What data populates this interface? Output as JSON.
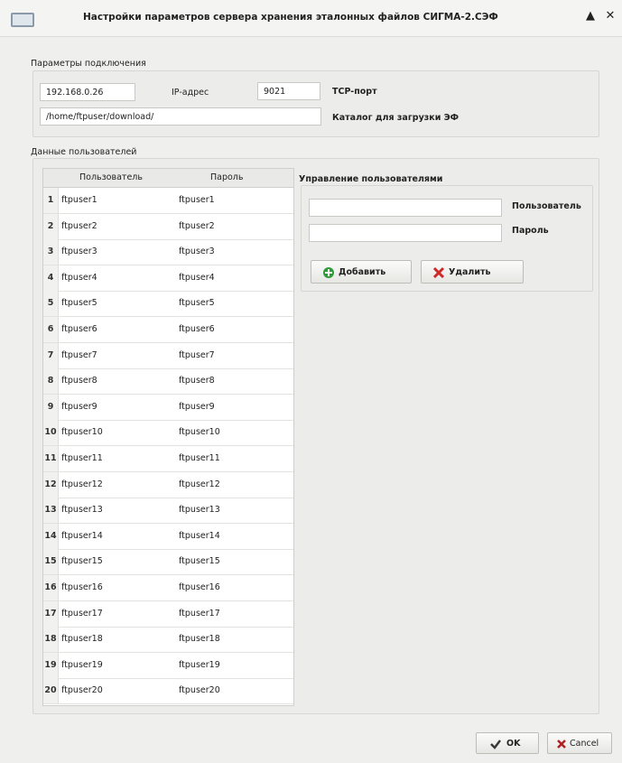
{
  "window": {
    "title": "Настройки параметров сервера хранения эталонных файлов СИГМА-2.СЭФ",
    "buttons": {
      "minimize": "▲",
      "close": "✕"
    }
  },
  "connection": {
    "group_label": "Параметры подключения",
    "ip_value": "192.168.0.26",
    "ip_label": "IP-адрес",
    "port_value": "9021",
    "port_label": "TCP-порт",
    "path_value": "/home/ftpuser/download/",
    "path_label": "Каталог для загрузки ЭФ"
  },
  "users": {
    "group_label": "Данные пользователей",
    "columns": [
      "Пользователь",
      "Пароль"
    ],
    "rows": [
      {
        "n": "1",
        "user": "ftpuser1",
        "pass": "ftpuser1"
      },
      {
        "n": "2",
        "user": "ftpuser2",
        "pass": "ftpuser2"
      },
      {
        "n": "3",
        "user": "ftpuser3",
        "pass": "ftpuser3"
      },
      {
        "n": "4",
        "user": "ftpuser4",
        "pass": "ftpuser4"
      },
      {
        "n": "5",
        "user": "ftpuser5",
        "pass": "ftpuser5"
      },
      {
        "n": "6",
        "user": "ftpuser6",
        "pass": "ftpuser6"
      },
      {
        "n": "7",
        "user": "ftpuser7",
        "pass": "ftpuser7"
      },
      {
        "n": "8",
        "user": "ftpuser8",
        "pass": "ftpuser8"
      },
      {
        "n": "9",
        "user": "ftpuser9",
        "pass": "ftpuser9"
      },
      {
        "n": "10",
        "user": "ftpuser10",
        "pass": "ftpuser10"
      },
      {
        "n": "11",
        "user": "ftpuser11",
        "pass": "ftpuser11"
      },
      {
        "n": "12",
        "user": "ftpuser12",
        "pass": "ftpuser12"
      },
      {
        "n": "13",
        "user": "ftpuser13",
        "pass": "ftpuser13"
      },
      {
        "n": "14",
        "user": "ftpuser14",
        "pass": "ftpuser14"
      },
      {
        "n": "15",
        "user": "ftpuser15",
        "pass": "ftpuser15"
      },
      {
        "n": "16",
        "user": "ftpuser16",
        "pass": "ftpuser16"
      },
      {
        "n": "17",
        "user": "ftpuser17",
        "pass": "ftpuser17"
      },
      {
        "n": "18",
        "user": "ftpuser18",
        "pass": "ftpuser18"
      },
      {
        "n": "19",
        "user": "ftpuser19",
        "pass": "ftpuser19"
      },
      {
        "n": "20",
        "user": "ftpuser20",
        "pass": "ftpuser20"
      }
    ]
  },
  "management": {
    "group_label": "Управление пользователями",
    "user_label": "Пользователь",
    "user_value": "",
    "pass_label": "Пароль",
    "pass_value": "",
    "add_label": "Добавить",
    "delete_label": "Удалить"
  },
  "footer": {
    "ok_label": "OK",
    "cancel_label": "Cancel"
  }
}
